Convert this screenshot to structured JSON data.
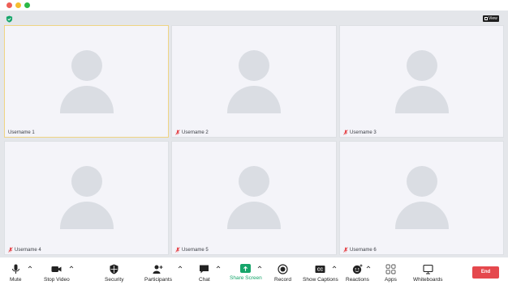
{
  "window": {
    "controls": [
      "close",
      "minimize",
      "maximize"
    ]
  },
  "header": {
    "security_icon": "shield-check-icon",
    "view_label": "View"
  },
  "participants": [
    {
      "name": "Username 1",
      "muted": false,
      "active_speaker": true
    },
    {
      "name": "Username 2",
      "muted": true,
      "active_speaker": false
    },
    {
      "name": "Username 3",
      "muted": true,
      "active_speaker": false
    },
    {
      "name": "Username 4",
      "muted": true,
      "active_speaker": false
    },
    {
      "name": "Username 5",
      "muted": true,
      "active_speaker": false
    },
    {
      "name": "Username 6",
      "muted": true,
      "active_speaker": false
    }
  ],
  "toolbar": {
    "mute": "Mute",
    "stop_video": "Stop Video",
    "security": "Security",
    "participants": "Participants",
    "chat": "Chat",
    "share_screen": "Share Screen",
    "record": "Record",
    "show_captions": "Show Captions",
    "captions_icon_text": "CC",
    "reactions": "Reactions",
    "apps": "Apps",
    "whiteboards": "Whiteboards",
    "end": "End"
  },
  "colors": {
    "active_speaker_border": "#efd483",
    "share_green": "#16a56a",
    "end_red": "#e5484d",
    "muted_red": "#e5484d"
  }
}
